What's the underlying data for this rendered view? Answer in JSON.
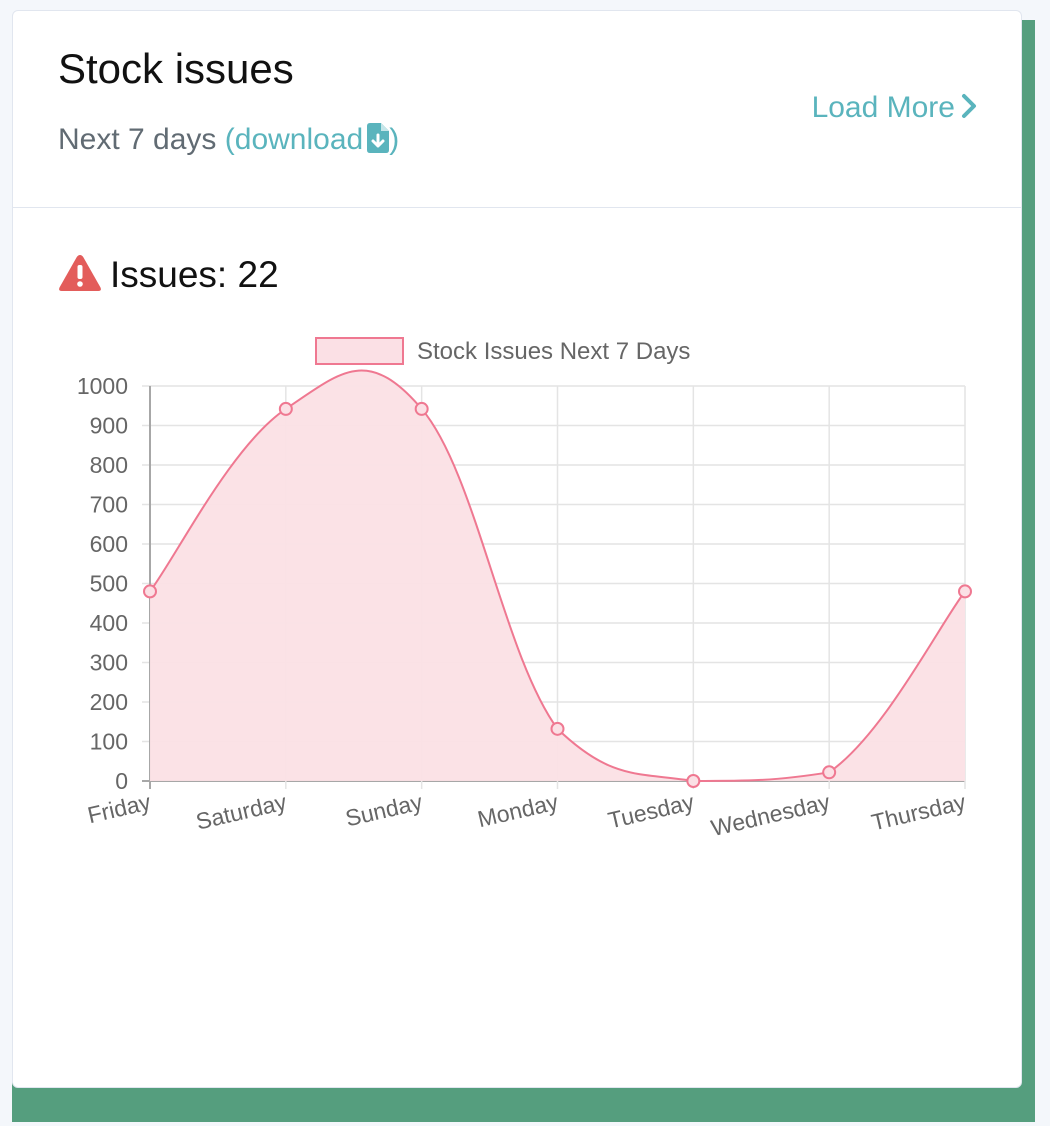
{
  "card": {
    "title": "Stock issues",
    "subtitle": "Next 7 days",
    "paren_open": "(",
    "download_label": "download",
    "paren_close": ")",
    "load_more_label": "Load More",
    "issues_label": "Issues:",
    "issues_count": "22"
  },
  "icons": {
    "download": "file-download-icon",
    "load_more": "chevron-right-icon",
    "warning": "warning-triangle-icon"
  },
  "colors": {
    "accent": "#5ab4bd",
    "warning": "#e35d5b",
    "series_line": "#ef7891",
    "series_fill": "#fbe0e5",
    "frame_shadow": "#559e7e"
  },
  "chart_data": {
    "type": "area",
    "legend_position": "top",
    "grid": true,
    "categories": [
      "Friday",
      "Saturday",
      "Sunday",
      "Monday",
      "Tuesday",
      "Wednesday",
      "Thursday"
    ],
    "series": [
      {
        "name": "Stock Issues Next 7 Days",
        "values": [
          480,
          942,
          942,
          132,
          0,
          22,
          480
        ]
      }
    ],
    "ylim": [
      0,
      1000
    ],
    "yticks": [
      0,
      100,
      200,
      300,
      400,
      500,
      600,
      700,
      800,
      900,
      1000
    ]
  }
}
